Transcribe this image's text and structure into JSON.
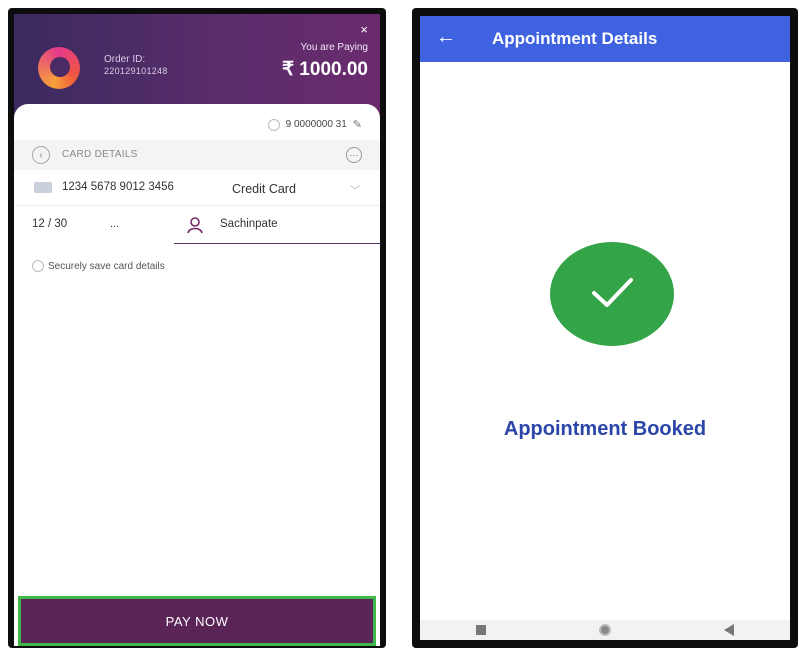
{
  "payment": {
    "order_label": "Order ID:",
    "order_id": "220129101248",
    "close": "×",
    "paying_label": "You are Paying",
    "amount": "₹ 1000.00",
    "phone": "9 0000000 31",
    "card_details_label": "CARD DETAILS",
    "card_number": "1234 5678 9012 3456",
    "card_type": "Credit Card",
    "expiry": "12 / 30",
    "cvv": "...",
    "cardholder_name": "Sachinpate",
    "save_label": "Securely save card details",
    "pay_button": "PAY NOW",
    "colors": {
      "header": "#5a2d6b",
      "button": "#5a2456",
      "highlight": "#3fb84a"
    }
  },
  "appointment": {
    "back": "←",
    "title": "Appointment Details",
    "status": "Appointment Booked",
    "colors": {
      "appbar": "#3f63e0",
      "success": "#34a448",
      "status_text": "#2b45a8"
    }
  }
}
